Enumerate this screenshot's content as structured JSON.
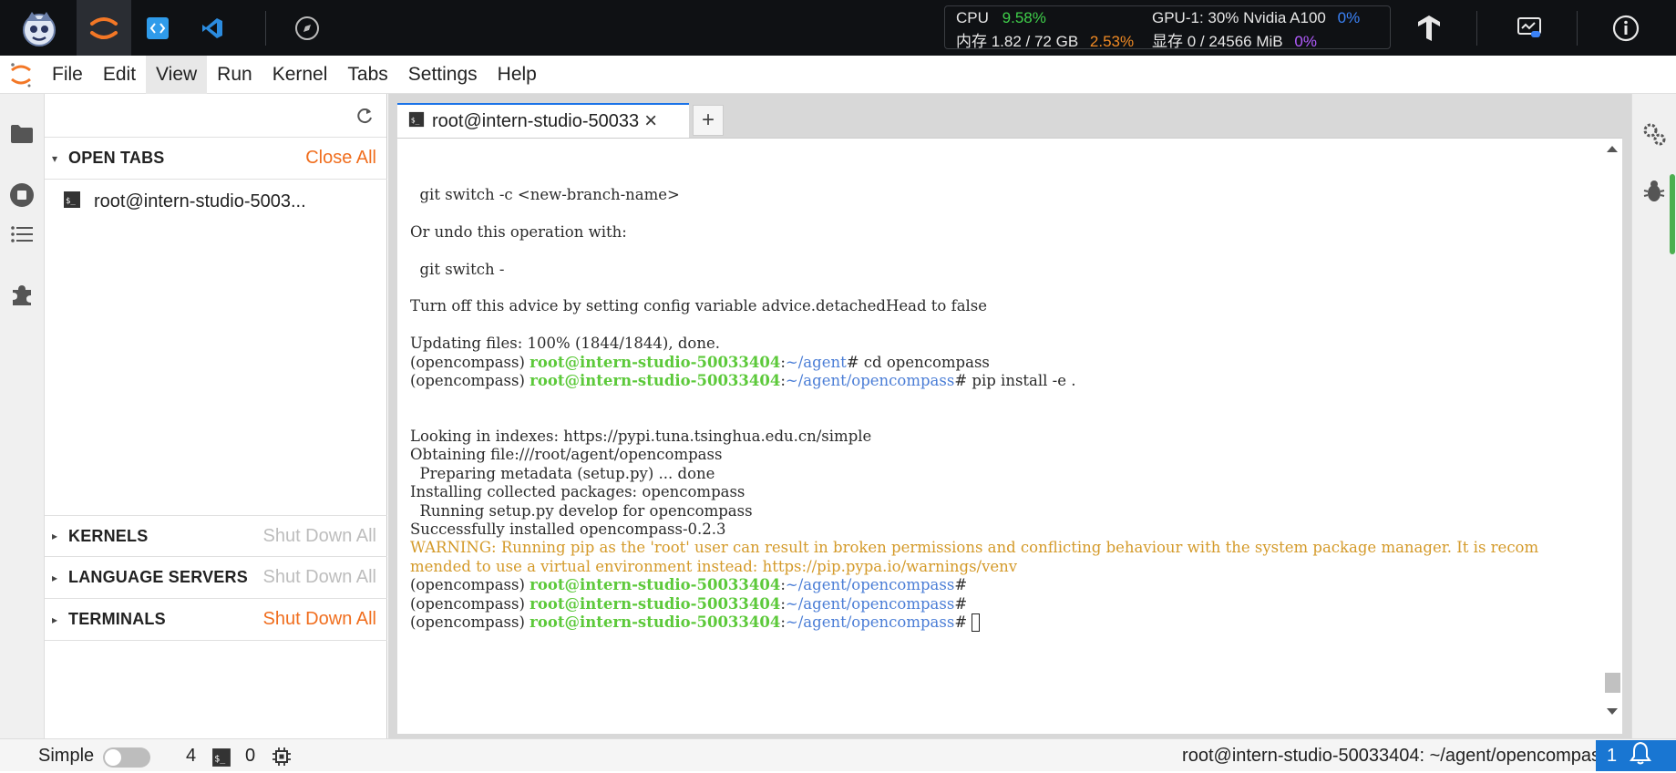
{
  "topbar": {
    "stats": {
      "cpu_label": "CPU",
      "cpu_value": "9.58%",
      "mem_label": "内存 1.82 / 72 GB",
      "mem_pct": "2.53%",
      "gpu_label": "GPU-1: 30% Nvidia A100",
      "gpu_util": "0%",
      "vram_label": "显存 0 / 24566 MiB",
      "vram_pct": "0%"
    }
  },
  "menu": {
    "items": [
      "File",
      "Edit",
      "View",
      "Run",
      "Kernel",
      "Tabs",
      "Settings",
      "Help"
    ],
    "active": "View"
  },
  "sidepanel": {
    "open_tabs": {
      "title": "OPEN TABS",
      "action": "Close All",
      "items": [
        "root@intern-studio-5003..."
      ]
    },
    "kernels": {
      "title": "KERNELS",
      "action": "Shut Down All"
    },
    "language_servers": {
      "title": "LANGUAGE SERVERS",
      "action": "Shut Down All"
    },
    "terminals": {
      "title": "TERMINALS",
      "action": "Shut Down All"
    }
  },
  "tabs": {
    "active_label": "root@intern-studio-50033",
    "close_glyph": "×",
    "add_glyph": "+"
  },
  "terminal": {
    "prompt_env": "(opencompass) ",
    "prompt_user": "root@intern-studio-50033404",
    "lines": [
      {
        "text": "  git switch -c <new-branch-name>"
      },
      {
        "text": ""
      },
      {
        "text": "Or undo this operation with:"
      },
      {
        "text": ""
      },
      {
        "text": "  git switch -"
      },
      {
        "text": ""
      },
      {
        "text": "Turn off this advice by setting config variable advice.detachedHead to false"
      },
      {
        "text": ""
      },
      {
        "text": "Updating files: 100% (1844/1844), done."
      },
      {
        "prompt": true,
        "path": "~/agent",
        "cmd": " cd opencompass"
      },
      {
        "prompt": true,
        "path": "~/agent/opencompass",
        "cmd": " pip install -e ."
      },
      {
        "text": ""
      },
      {
        "text": ""
      },
      {
        "text": "Looking in indexes: https://pypi.tuna.tsinghua.edu.cn/simple"
      },
      {
        "text": "Obtaining file:///root/agent/opencompass"
      },
      {
        "text": "  Preparing metadata (setup.py) ... done"
      },
      {
        "text": "Installing collected packages: opencompass"
      },
      {
        "text": "  Running setup.py develop for opencompass"
      },
      {
        "text": "Successfully installed opencompass-0.2.3"
      },
      {
        "warn": "WARNING: Running pip as the 'root' user can result in broken permissions and conflicting behaviour with the system package manager. It is recom"
      },
      {
        "warn": "mended to use a virtual environment instead: https://pip.pypa.io/warnings/venv"
      },
      {
        "prompt": true,
        "path": "~/agent/opencompass",
        "cmd": ""
      },
      {
        "prompt": true,
        "path": "~/agent/opencompass",
        "cmd": ""
      },
      {
        "prompt": true,
        "path": "~/agent/opencompass",
        "cmd": " ",
        "cursor": true
      }
    ]
  },
  "statusbar": {
    "mode_label": "Simple",
    "count_kernels": "4",
    "count_terminals": "0",
    "path": "root@intern-studio-50033404: ~/agent/opencompass",
    "notifications": "1"
  }
}
